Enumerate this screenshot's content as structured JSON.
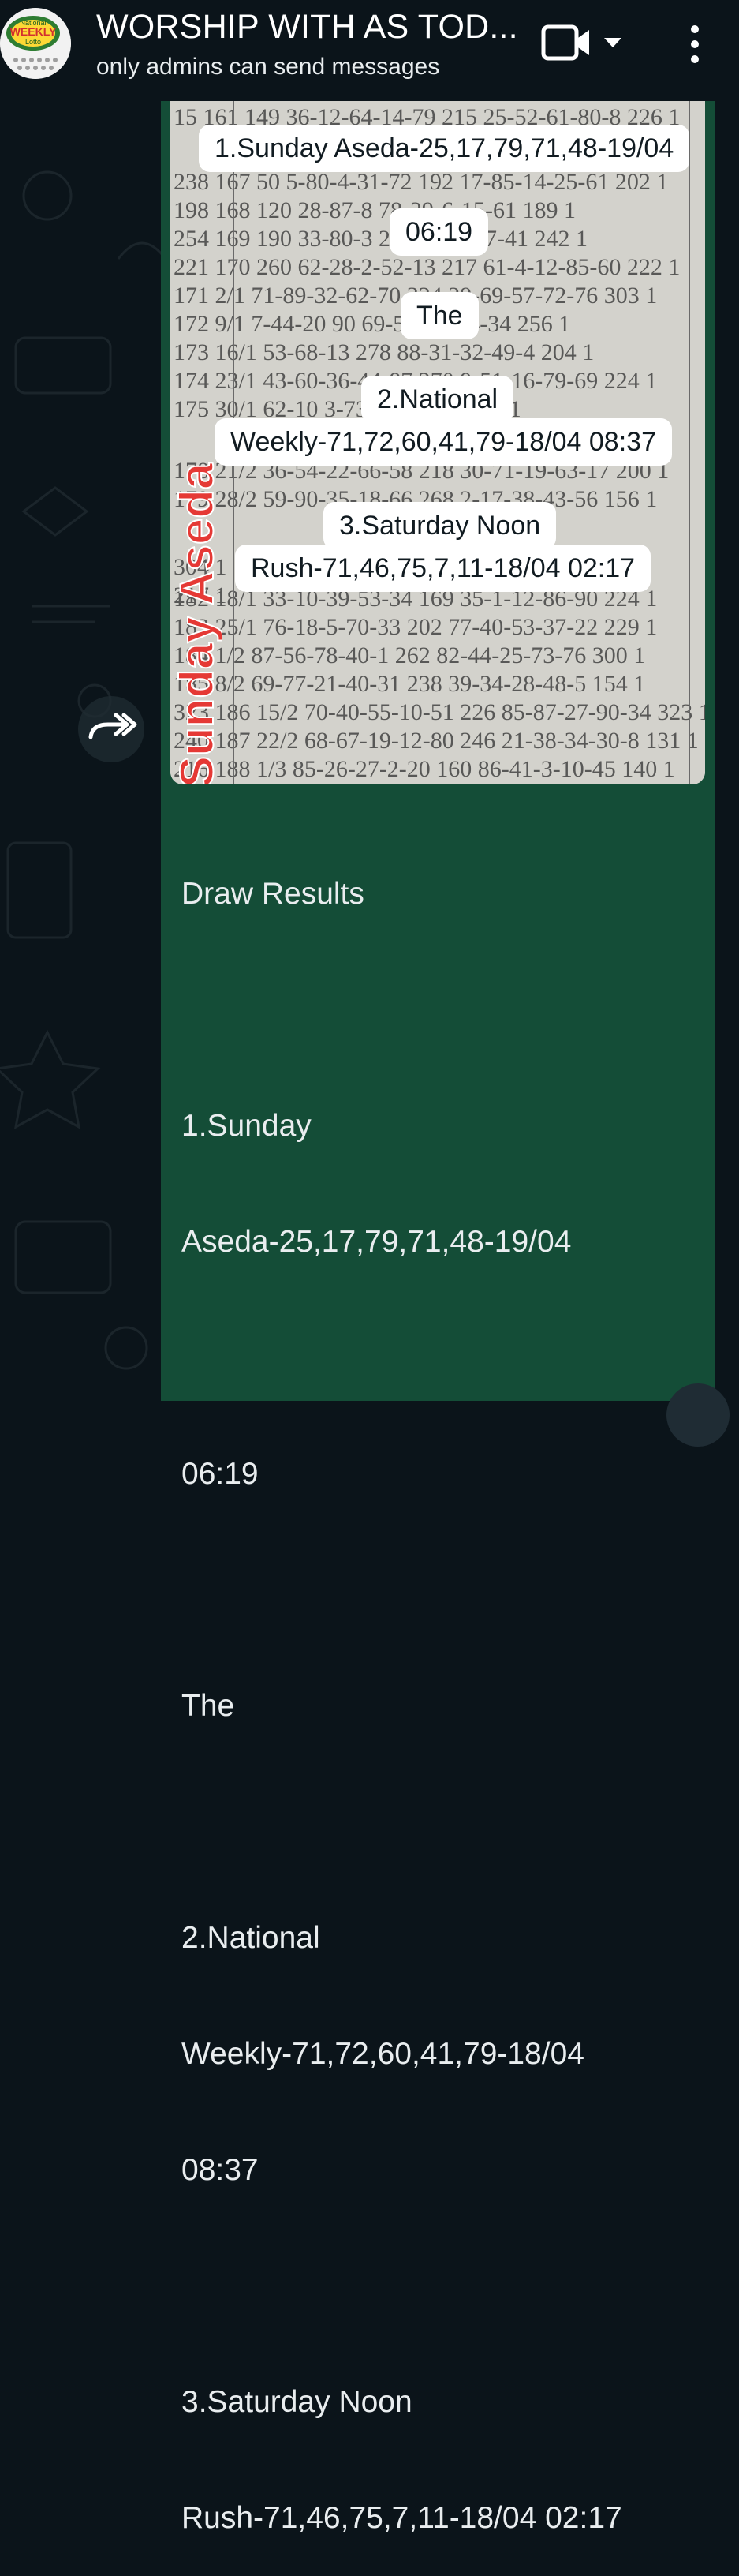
{
  "header": {
    "title": "WORSHIP WITH AS TOD...",
    "subtitle": "only admins can send messages",
    "avatar_logo": {
      "line1": "National",
      "line2": "WEEKLY",
      "line3": "Lotto"
    }
  },
  "message": {
    "image_overlay": {
      "line1": "1.Sunday Aseda-25,17,79,71,48-19/04",
      "line2": "06:19",
      "line3": "The",
      "line4": "2.National",
      "line5": "Weekly-71,72,60,41,79-18/04 08:37",
      "line6": "3.Saturday Noon",
      "line7": "Rush-71,46,75,7,11-18/04 02:17"
    },
    "image_vertical_text": "Sunday Aseda",
    "caption": {
      "line1": "Draw Results",
      "line2": "1.Sunday",
      "line3": "Aseda-25,17,79,71,48-19/04",
      "line4": "06:19",
      "line5": "The",
      "line6": "2.National",
      "line7": "Weekly-71,72,60,41,79-18/04",
      "line8": "08:37",
      "line9": "3.Saturday Noon",
      "line10": "Rush-71,46,75,7,11-18/04 02:17"
    }
  },
  "icons": {
    "video": "video-call-icon",
    "dropdown": "chevron-down-icon",
    "menu": "more-vertical-icon",
    "forward": "forward-icon"
  },
  "colors": {
    "background": "#0b141a",
    "bubble": "#144d37",
    "text": "#e9edef",
    "accent_red": "#e53935"
  }
}
